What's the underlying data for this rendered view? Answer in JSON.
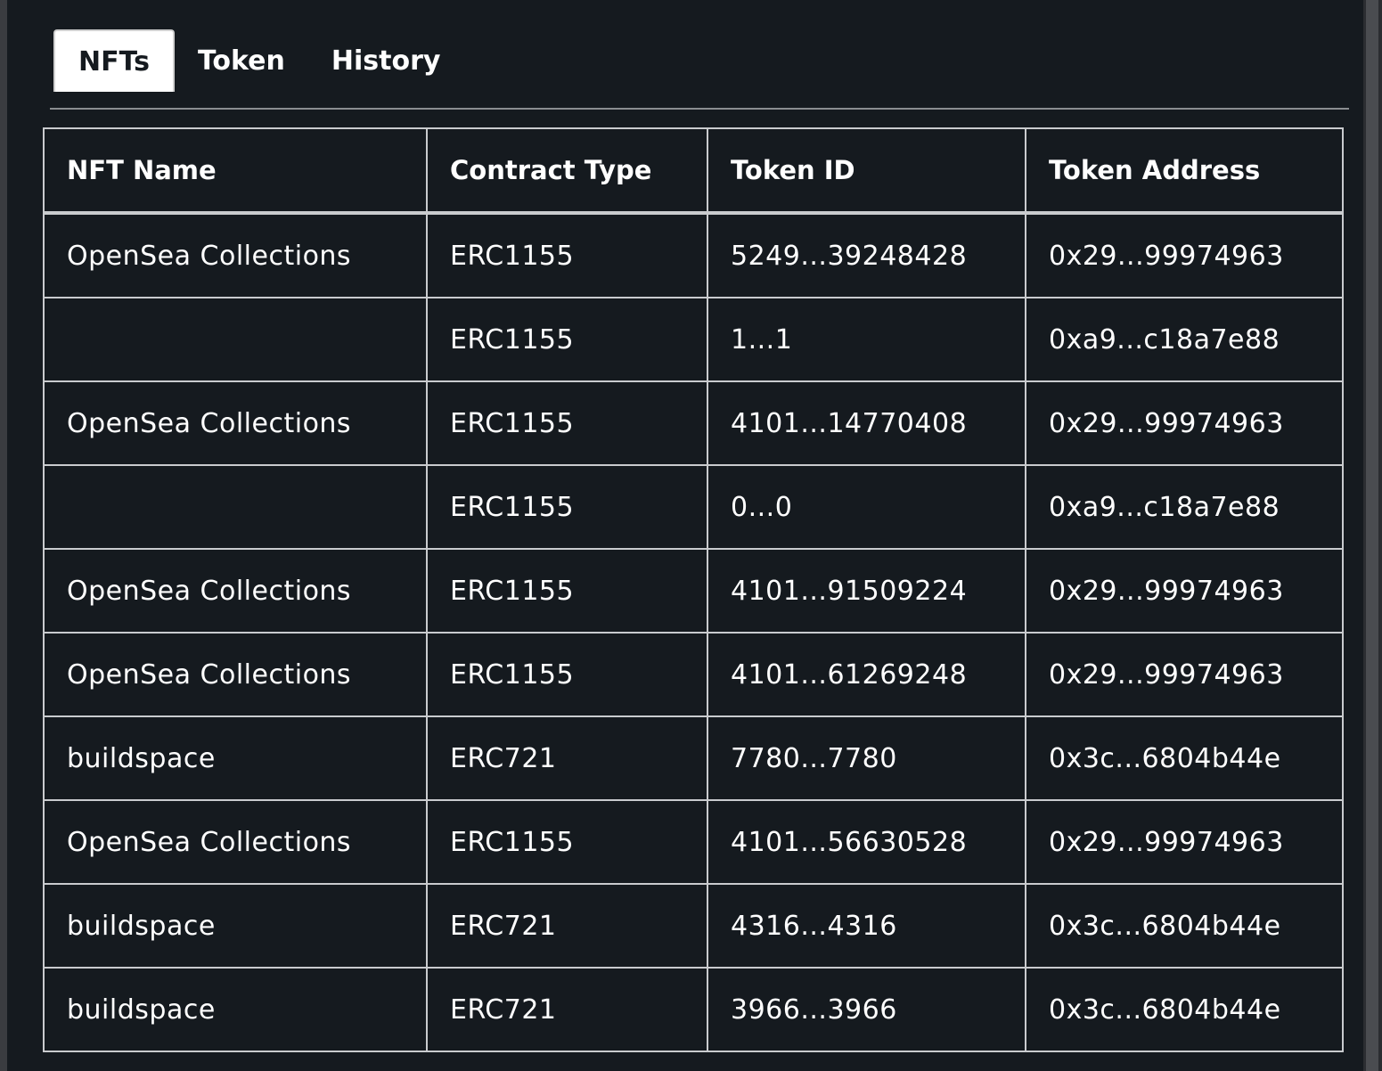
{
  "tabs": [
    {
      "label": "NFTs",
      "active": true
    },
    {
      "label": "Token",
      "active": false
    },
    {
      "label": "History",
      "active": false
    }
  ],
  "table": {
    "headers": [
      "NFT Name",
      "Contract Type",
      "Token ID",
      "Token Address"
    ],
    "rows": [
      [
        "OpenSea Collections",
        "ERC1155",
        "5249...39248428",
        "0x29...99974963"
      ],
      [
        "",
        "ERC1155",
        "1...1",
        "0xa9...c18a7e88"
      ],
      [
        "OpenSea Collections",
        "ERC1155",
        "4101...14770408",
        "0x29...99974963"
      ],
      [
        "",
        "ERC1155",
        "0...0",
        "0xa9...c18a7e88"
      ],
      [
        "OpenSea Collections",
        "ERC1155",
        "4101...91509224",
        "0x29...99974963"
      ],
      [
        "OpenSea Collections",
        "ERC1155",
        "4101...61269248",
        "0x29...99974963"
      ],
      [
        "buildspace",
        "ERC721",
        "7780...7780",
        "0x3c...6804b44e"
      ],
      [
        "OpenSea Collections",
        "ERC1155",
        "4101...56630528",
        "0x29...99974963"
      ],
      [
        "buildspace",
        "ERC721",
        "4316...4316",
        "0x3c...6804b44e"
      ],
      [
        "buildspace",
        "ERC721",
        "3966...3966",
        "0x3c...6804b44e"
      ]
    ]
  },
  "colors": {
    "background": "#151a1f",
    "text": "#ffffff",
    "border": "#c9cbce",
    "active_tab_bg": "#ffffff"
  }
}
